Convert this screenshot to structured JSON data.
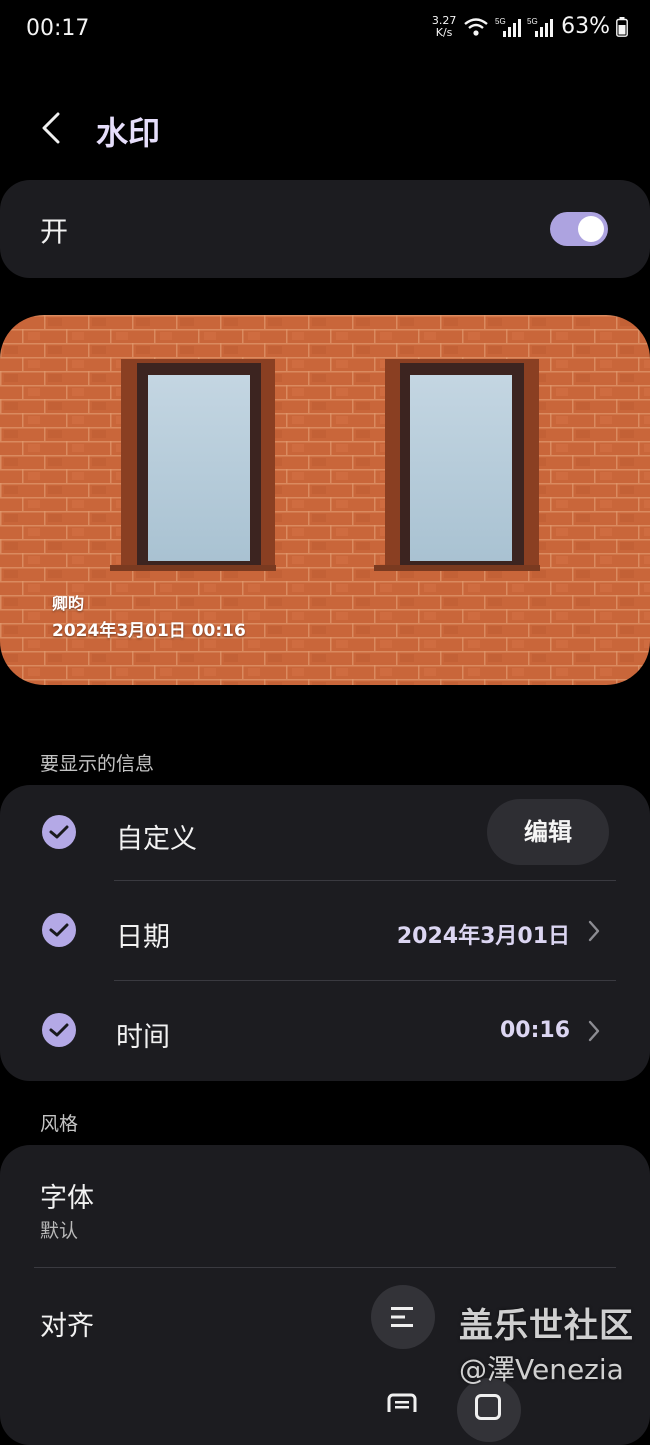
{
  "status_bar": {
    "time": "00:17",
    "net_speed_value": "3.27",
    "net_speed_unit": "K/s",
    "battery": "63%",
    "icons": [
      "wifi-icon",
      "signal-5g-icon",
      "signal-5g-icon",
      "battery-icon"
    ]
  },
  "header": {
    "title": "水印",
    "back_icon": "chevron-left-icon"
  },
  "toggle": {
    "label": "开",
    "enabled": true,
    "color": "#ada3e0"
  },
  "preview": {
    "watermark_name": "卿昀",
    "watermark_datetime": "2024年3月01日 00:16"
  },
  "info_section": {
    "label": "要显示的信息",
    "items": [
      {
        "label": "自定义",
        "checked": true,
        "button": "编辑"
      },
      {
        "label": "日期",
        "checked": true,
        "value": "2024年3月01日"
      },
      {
        "label": "时间",
        "checked": true,
        "value": "00:16"
      }
    ]
  },
  "style_section": {
    "label": "风格",
    "font_label": "字体",
    "font_value": "默认",
    "align_label": "对齐"
  },
  "overlay_watermark": {
    "forum": "盖乐世社区",
    "user": "@澤Venezia"
  },
  "colors": {
    "accent": "#b4a9e6",
    "card": "#1c1c20",
    "title": "#e6defb"
  }
}
